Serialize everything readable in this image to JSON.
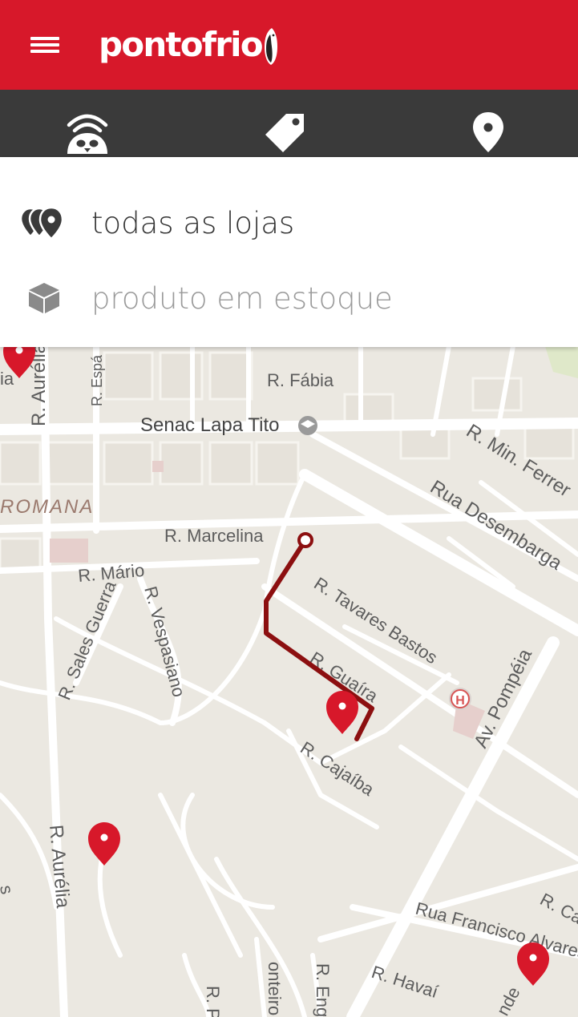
{
  "app": {
    "brand_name": "pontofrio",
    "accent_color": "#d7182a",
    "tabbar_color": "#3a3a3a"
  },
  "header": {
    "menu_icon": "hamburger-menu-icon"
  },
  "tabs": [
    {
      "icon": "wifi-penguin-icon"
    },
    {
      "icon": "price-tag-icon"
    },
    {
      "icon": "map-pin-icon"
    }
  ],
  "filters": {
    "all_stores": {
      "label": "todas as lojas",
      "icon": "multiple-pins-icon"
    },
    "in_stock": {
      "label": "produto em estoque",
      "icon": "box-icon"
    }
  },
  "map": {
    "street_labels": {
      "fabia": "R. Fábia",
      "senac": "Senac Lapa Tito",
      "min_ferreira": "R. Min. Ferrer",
      "desembargador": "Rua Desembarga",
      "romana": "ROMANA",
      "marcelina": "R. Marcelina",
      "mario": "R. Mário",
      "sales_guerra": "R. Sales Guerra",
      "vespasiano": "R. Vespasiano",
      "tavares_bastos": "R. Tavares Bastos",
      "guaira": "R. Guaíra",
      "cajaiba": "R. Cajaíba",
      "pompeia": "Av. Pompéia",
      "aurelia_top": "R. Aurélia",
      "aurelia_bottom": "R. Aurélia",
      "espa": "R. Espá",
      "francisco": "Rua Francisco Alvares",
      "havai": "R. Havaí",
      "r_ca": "R. Ca",
      "monteiro": "onteiro",
      "r_eng": "R. Eng",
      "r_p": "R. P",
      "nde": "nde",
      "ia_left": "ia",
      "s_left": "s"
    },
    "hospital_icon": "hospital-icon",
    "education_icon": "graduation-cap-icon",
    "route_color": "#8c0f10",
    "pin_color": "#d7182a"
  }
}
